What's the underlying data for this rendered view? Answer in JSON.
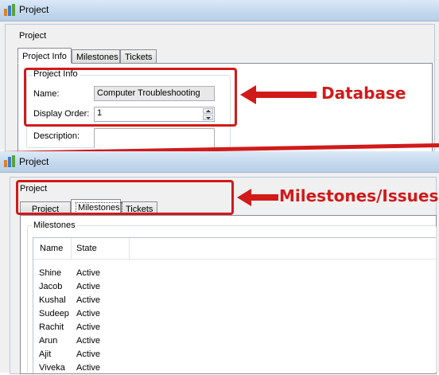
{
  "window1": {
    "title": "Project",
    "group_title": "Project",
    "tabs": [
      "Project Info",
      "Milestones",
      "Tickets"
    ],
    "active_tab": "Project Info",
    "project_info_group": "Project Info",
    "fields": {
      "name_label": "Name:",
      "name_value": "Computer Troubleshooting",
      "display_order_label": "Display Order:",
      "display_order_value": "1",
      "description_label": "Description:"
    }
  },
  "window2": {
    "title": "Project",
    "group_title": "Project",
    "tabs": [
      "Project Info",
      "Milestones",
      "Tickets"
    ],
    "active_tab": "Milestones",
    "milestones_group": "Milestones",
    "columns": [
      "Name",
      "State"
    ],
    "rows": [
      {
        "name": "Shine",
        "state": "Active"
      },
      {
        "name": "Jacob",
        "state": "Active"
      },
      {
        "name": "Kushal",
        "state": "Active"
      },
      {
        "name": "Sudeep",
        "state": "Active"
      },
      {
        "name": "Rachit",
        "state": "Active"
      },
      {
        "name": "Arun",
        "state": "Active"
      },
      {
        "name": "Ajit",
        "state": "Active"
      },
      {
        "name": "Viveka",
        "state": "Active"
      }
    ]
  },
  "annotations": {
    "database": "Database",
    "milestones_issues": "Milestones/Issues",
    "color": "#d11a1a"
  },
  "icons": {
    "app": "bar-chart-icon",
    "spin_up": "chevron-up-icon",
    "spin_down": "chevron-down-icon",
    "arrow": "arrow-left-icon"
  }
}
